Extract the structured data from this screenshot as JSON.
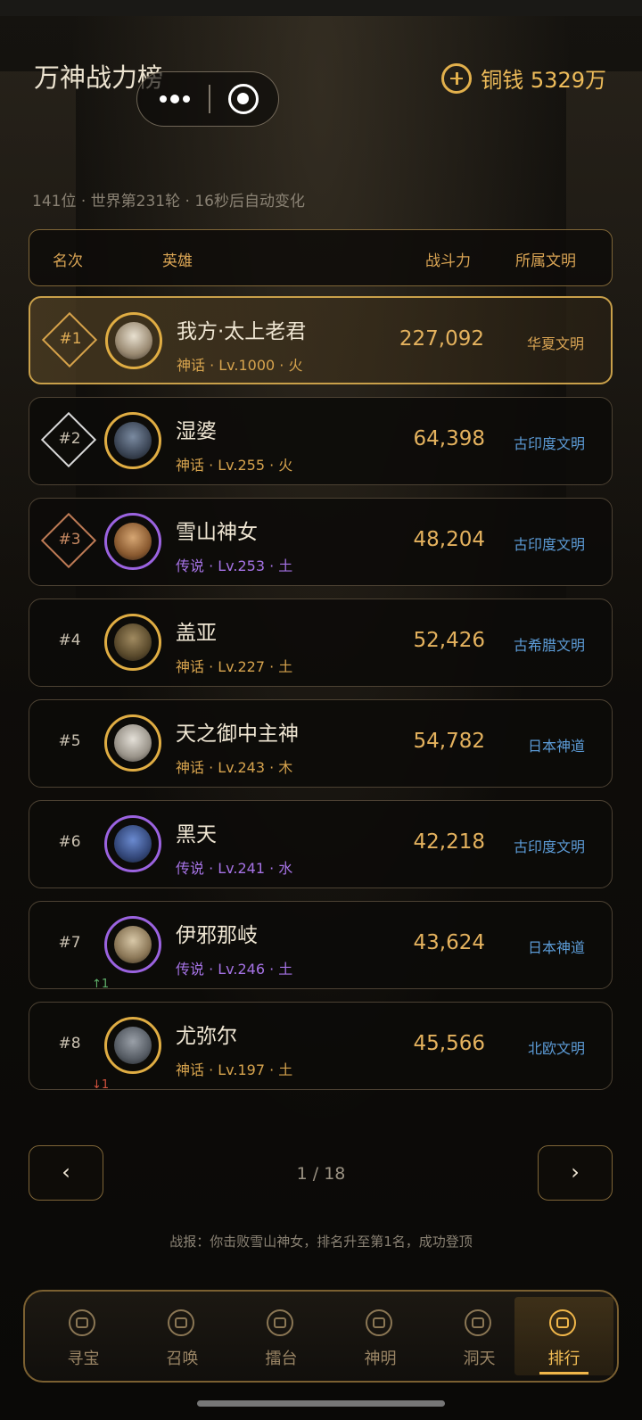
{
  "header": {
    "title": "万神战力榜",
    "currency_text": "铜钱 5329万",
    "subinfo": "141位 · 世界第231轮 · 16秒后自动变化"
  },
  "table_header": {
    "rank": "名次",
    "hero": "英雄",
    "power": "战斗力",
    "civ": "所属文明"
  },
  "rows": [
    {
      "rank": "#1",
      "name": "我方·太上老君",
      "meta": "神话 · Lv.1000 · 火",
      "power": "227,092",
      "civ": "华夏文明"
    },
    {
      "rank": "#2",
      "name": "湿婆",
      "meta": "神话 · Lv.255 · 火",
      "power": "64,398",
      "civ": "古印度文明"
    },
    {
      "rank": "#3",
      "name": "雪山神女",
      "meta": "传说 · Lv.253 · 土",
      "power": "48,204",
      "civ": "古印度文明"
    },
    {
      "rank": "#4",
      "name": "盖亚",
      "meta": "神话 · Lv.227 · 土",
      "power": "52,426",
      "civ": "古希腊文明"
    },
    {
      "rank": "#5",
      "name": "天之御中主神",
      "meta": "神话 · Lv.243 · 木",
      "power": "54,782",
      "civ": "日本神道"
    },
    {
      "rank": "#6",
      "name": "黑天",
      "meta": "传说 · Lv.241 · 水",
      "power": "42,218",
      "civ": "古印度文明"
    },
    {
      "rank": "#7",
      "name": "伊邪那岐",
      "meta": "传说 · Lv.246 · 土",
      "power": "43,624",
      "civ": "日本神道",
      "change": "↑1"
    },
    {
      "rank": "#8",
      "name": "尤弥尔",
      "meta": "神话 · Lv.197 · 土",
      "power": "45,566",
      "civ": "北欧文明",
      "change": "↓1"
    }
  ],
  "pager": {
    "prev": "‹",
    "next": "›",
    "text": "1 / 18"
  },
  "battle_report": "战报：你击败雪山神女，排名升至第1名，成功登顶",
  "tabs": [
    {
      "label": "寻宝",
      "icon": "treasure-icon"
    },
    {
      "label": "召唤",
      "icon": "summon-icon"
    },
    {
      "label": "擂台",
      "icon": "arena-icon"
    },
    {
      "label": "神明",
      "icon": "deity-icon"
    },
    {
      "label": "洞天",
      "icon": "cave-icon"
    },
    {
      "label": "排行",
      "icon": "ranking-icon",
      "active": true
    }
  ],
  "colors": {
    "gold_accent": "#e2b04c",
    "civ_blue": "#5c9bd6",
    "legend_purple": "#a673e6",
    "myth_gold": "#d7a44e"
  }
}
